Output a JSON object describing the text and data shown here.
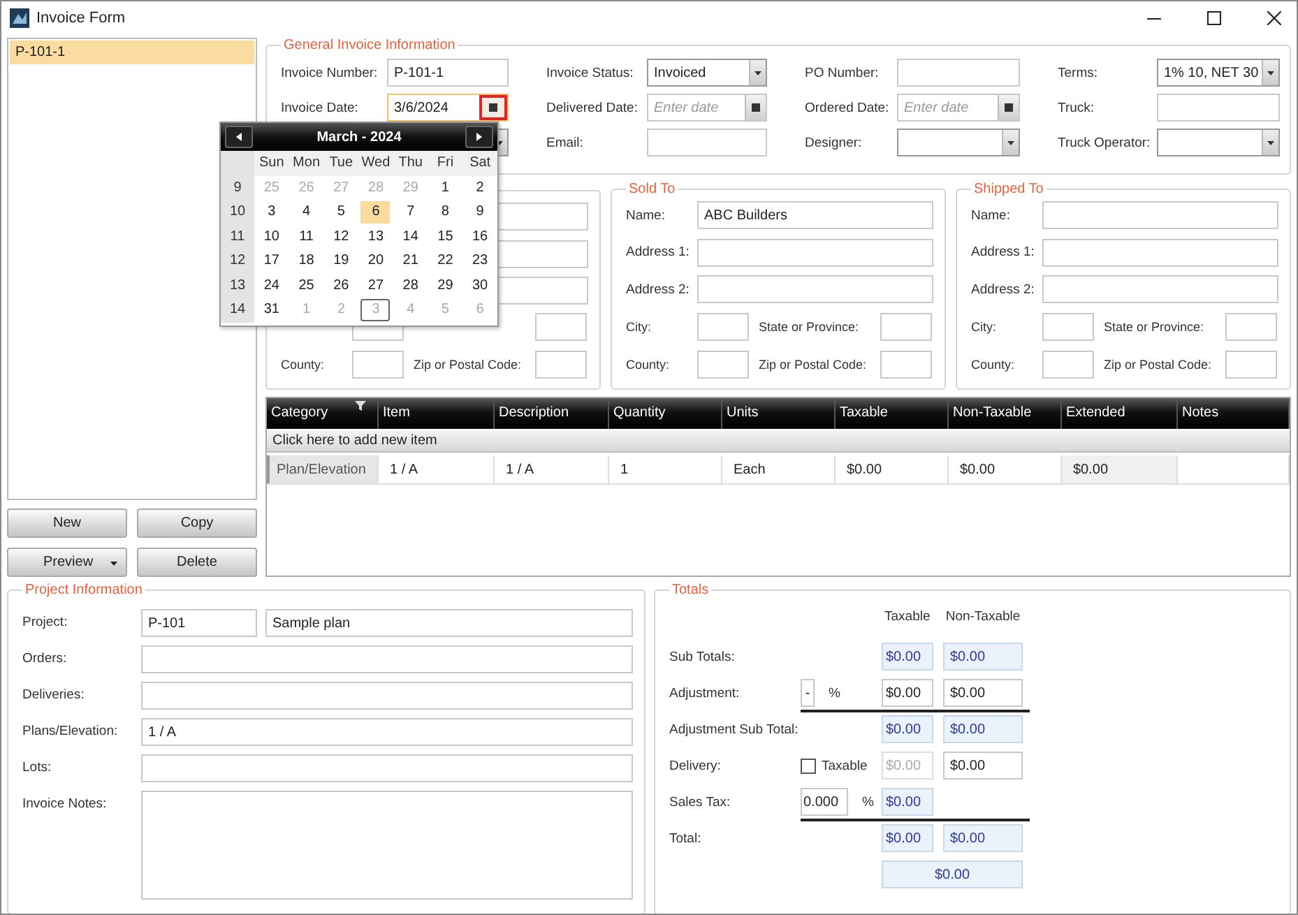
{
  "window": {
    "title": "Invoice Form"
  },
  "sidebar": {
    "items": [
      {
        "label": "P-101-1",
        "selected": true
      }
    ],
    "buttons": [
      {
        "label": "New",
        "kind": "plain"
      },
      {
        "label": "Copy",
        "kind": "plain"
      },
      {
        "label": "Preview",
        "kind": "split"
      },
      {
        "label": "Delete",
        "kind": "plain"
      }
    ]
  },
  "general": {
    "title": "General Invoice Information",
    "rows": [
      [
        {
          "label": "Invoice Number:",
          "kind": "text",
          "value": "P-101-1"
        },
        {
          "label": "Invoice Status:",
          "kind": "dropdown",
          "value": "Invoiced"
        },
        {
          "label": "PO Number:",
          "kind": "text"
        },
        {
          "label": "Terms:",
          "kind": "dropdown",
          "value": "1% 10, NET 30"
        }
      ],
      [
        {
          "label": "Invoice Date:",
          "kind": "date",
          "value": "3/6/2024",
          "focused": true,
          "button_marked": true
        },
        {
          "label": "Delivered Date:",
          "kind": "date",
          "placeholder": "Enter date",
          "focused": false,
          "button_marked": false
        },
        {
          "label": "Ordered Date:",
          "kind": "date",
          "placeholder": "Enter date",
          "focused": false,
          "button_marked": false
        },
        {
          "label": "Truck:",
          "kind": "text"
        }
      ],
      [
        {
          "kind": "dropdown"
        },
        {
          "label": "Email:",
          "kind": "text"
        },
        {
          "label": "Designer:",
          "kind": "dropdown"
        },
        {
          "label": "Truck Operator:",
          "kind": "dropdown"
        }
      ]
    ]
  },
  "calendar": {
    "title": "March - 2024",
    "weekdays": [
      "Sun",
      "Mon",
      "Tue",
      "Wed",
      "Thu",
      "Fri",
      "Sat"
    ],
    "weeks": [
      {
        "number": "9",
        "days": [
          {
            "day": "25",
            "other": true,
            "selected": false,
            "today": false
          },
          {
            "day": "26",
            "other": true,
            "selected": false,
            "today": false
          },
          {
            "day": "27",
            "other": true,
            "selected": false,
            "today": false
          },
          {
            "day": "28",
            "other": true,
            "selected": false,
            "today": false
          },
          {
            "day": "29",
            "other": true,
            "selected": false,
            "today": false
          },
          {
            "day": "1",
            "other": false,
            "selected": false,
            "today": false
          },
          {
            "day": "2",
            "other": false,
            "selected": false,
            "today": false
          }
        ]
      },
      {
        "number": "10",
        "days": [
          {
            "day": "3",
            "other": false,
            "selected": false,
            "today": false
          },
          {
            "day": "4",
            "other": false,
            "selected": false,
            "today": false
          },
          {
            "day": "5",
            "other": false,
            "selected": false,
            "today": false
          },
          {
            "day": "6",
            "other": false,
            "selected": true,
            "today": false
          },
          {
            "day": "7",
            "other": false,
            "selected": false,
            "today": false
          },
          {
            "day": "8",
            "other": false,
            "selected": false,
            "today": false
          },
          {
            "day": "9",
            "other": false,
            "selected": false,
            "today": false
          }
        ]
      },
      {
        "number": "11",
        "days": [
          {
            "day": "10",
            "other": false,
            "selected": false,
            "today": false
          },
          {
            "day": "11",
            "other": false,
            "selected": false,
            "today": false
          },
          {
            "day": "12",
            "other": false,
            "selected": false,
            "today": false
          },
          {
            "day": "13",
            "other": false,
            "selected": false,
            "today": false
          },
          {
            "day": "14",
            "other": false,
            "selected": false,
            "today": false
          },
          {
            "day": "15",
            "other": false,
            "selected": false,
            "today": false
          },
          {
            "day": "16",
            "other": false,
            "selected": false,
            "today": false
          }
        ]
      },
      {
        "number": "12",
        "days": [
          {
            "day": "17",
            "other": false,
            "selected": false,
            "today": false
          },
          {
            "day": "18",
            "other": false,
            "selected": false,
            "today": false
          },
          {
            "day": "19",
            "other": false,
            "selected": false,
            "today": false
          },
          {
            "day": "20",
            "other": false,
            "selected": false,
            "today": false
          },
          {
            "day": "21",
            "other": false,
            "selected": false,
            "today": false
          },
          {
            "day": "22",
            "other": false,
            "selected": false,
            "today": false
          },
          {
            "day": "23",
            "other": false,
            "selected": false,
            "today": false
          }
        ]
      },
      {
        "number": "13",
        "days": [
          {
            "day": "24",
            "other": false,
            "selected": false,
            "today": false
          },
          {
            "day": "25",
            "other": false,
            "selected": false,
            "today": false
          },
          {
            "day": "26",
            "other": false,
            "selected": false,
            "today": false
          },
          {
            "day": "27",
            "other": false,
            "selected": false,
            "today": false
          },
          {
            "day": "28",
            "other": false,
            "selected": false,
            "today": false
          },
          {
            "day": "29",
            "other": false,
            "selected": false,
            "today": false
          },
          {
            "day": "30",
            "other": false,
            "selected": false,
            "today": false
          }
        ]
      },
      {
        "number": "14",
        "days": [
          {
            "day": "31",
            "other": false,
            "selected": false,
            "today": false
          },
          {
            "day": "1",
            "other": true,
            "selected": false,
            "today": false
          },
          {
            "day": "2",
            "other": true,
            "selected": false,
            "today": false
          },
          {
            "day": "3",
            "other": true,
            "selected": false,
            "today": true
          },
          {
            "day": "4",
            "other": true,
            "selected": false,
            "today": false
          },
          {
            "day": "5",
            "other": true,
            "selected": false,
            "today": false
          },
          {
            "day": "6",
            "other": true,
            "selected": false,
            "today": false
          }
        ]
      }
    ]
  },
  "contact_groups": [
    {
      "rows": [
        [
          {}
        ],
        [
          {}
        ],
        [
          {}
        ],
        [
          {},
          {}
        ],
        [
          {
            "label": "County:"
          },
          {
            "label": "Zip or Postal Code:"
          }
        ]
      ]
    },
    {
      "title": "Sold To",
      "rows": [
        [
          {
            "label": "Name:",
            "value": "ABC Builders"
          }
        ],
        [
          {
            "label": "Address 1:"
          }
        ],
        [
          {
            "label": "Address 2:"
          }
        ],
        [
          {
            "label": "City:"
          },
          {
            "label": "State or Province:"
          }
        ],
        [
          {
            "label": "County:"
          },
          {
            "label": "Zip or Postal Code:"
          }
        ]
      ]
    },
    {
      "title": "Shipped To",
      "rows": [
        [
          {
            "label": "Name:"
          }
        ],
        [
          {
            "label": "Address 1:"
          }
        ],
        [
          {
            "label": "Address 2:"
          }
        ],
        [
          {
            "label": "City:"
          },
          {
            "label": "State or Province:"
          }
        ],
        [
          {
            "label": "County:"
          },
          {
            "label": "Zip or Postal Code:"
          }
        ]
      ]
    }
  ],
  "table": {
    "columns": [
      {
        "label": "Category",
        "kind": "header",
        "filter": true
      },
      {
        "label": "Item",
        "kind": "text",
        "filter": false
      },
      {
        "label": "Description",
        "kind": "text",
        "filter": false
      },
      {
        "label": "Quantity",
        "kind": "text",
        "filter": false
      },
      {
        "label": "Units",
        "kind": "text",
        "filter": false
      },
      {
        "label": "Taxable",
        "kind": "text",
        "filter": false
      },
      {
        "label": "Non-Taxable",
        "kind": "text",
        "filter": false
      },
      {
        "label": "Extended",
        "kind": "computed",
        "filter": false
      },
      {
        "label": "Notes",
        "kind": "text",
        "filter": false
      }
    ],
    "add_row": "Click here to add new item",
    "rows": [
      {
        "cells": [
          "Plan/Elevation",
          "1 / A",
          "1 / A",
          "1",
          "Each",
          "$0.00",
          "$0.00",
          "$0.00"
        ]
      }
    ]
  },
  "project": {
    "title": "Project Information",
    "rows": [
      {
        "label": "Project:",
        "fields": [
          {
            "kind": "short",
            "value": "P-101"
          },
          {
            "kind": "text",
            "value": "Sample plan"
          }
        ]
      },
      {
        "label": "Orders:",
        "fields": [
          {
            "kind": "text"
          }
        ]
      },
      {
        "label": "Deliveries:",
        "fields": [
          {
            "kind": "text"
          }
        ]
      },
      {
        "label": "Plans/Elevation:",
        "fields": [
          {
            "kind": "text",
            "value": "1 / A"
          }
        ]
      },
      {
        "label": "Lots:",
        "fields": [
          {
            "kind": "text"
          }
        ]
      },
      {
        "label": "Invoice Notes:",
        "fields": [
          {
            "kind": "multiline"
          }
        ]
      }
    ]
  },
  "totals": {
    "title": "Totals",
    "headers": [
      "Taxable",
      "Non-Taxable"
    ],
    "rows": [
      {
        "kind": "amounts",
        "label": "Sub Totals:",
        "taxable": {
          "kind": "readonly",
          "value": "$0.00"
        },
        "non_taxable": {
          "kind": "readonly",
          "value": "$0.00"
        }
      },
      {
        "kind": "amounts",
        "label": "Adjustment:",
        "extra": {
          "kind": "adjust",
          "sign": "-",
          "unit": "%"
        },
        "taxable": {
          "kind": "input",
          "value": "$0.00"
        },
        "non_taxable": {
          "kind": "input",
          "value": "$0.00"
        }
      },
      {
        "kind": "rule"
      },
      {
        "kind": "amounts",
        "label": "Adjustment Sub Total:",
        "taxable": {
          "kind": "readonly",
          "value": "$0.00"
        },
        "non_taxable": {
          "kind": "readonly",
          "value": "$0.00"
        }
      },
      {
        "kind": "amounts",
        "label": "Delivery:",
        "extra": {
          "kind": "checkbox",
          "label": "Taxable",
          "checked": false
        },
        "taxable": {
          "kind": "disabled",
          "value": "$0.00"
        },
        "non_taxable": {
          "kind": "input",
          "value": "$0.00"
        }
      },
      {
        "kind": "amounts",
        "label": "Sales Tax:",
        "extra": {
          "kind": "rate",
          "value": "0.000",
          "unit": "%"
        },
        "taxable": {
          "kind": "readonly",
          "value": "$0.00"
        }
      },
      {
        "kind": "rule"
      },
      {
        "kind": "amounts",
        "label": "Total:",
        "taxable": {
          "kind": "readonly",
          "value": "$0.00"
        },
        "non_taxable": {
          "kind": "readonly",
          "value": "$0.00"
        }
      }
    ],
    "grand_total": {
      "kind": "readonly",
      "value": "$0.00"
    }
  }
}
